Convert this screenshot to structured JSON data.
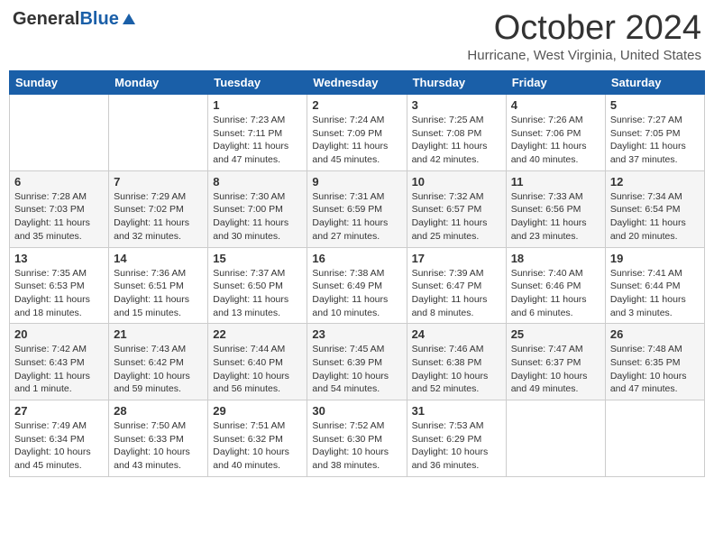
{
  "header": {
    "logo_general": "General",
    "logo_blue": "Blue",
    "month_title": "October 2024",
    "location": "Hurricane, West Virginia, United States"
  },
  "days_of_week": [
    "Sunday",
    "Monday",
    "Tuesday",
    "Wednesday",
    "Thursday",
    "Friday",
    "Saturday"
  ],
  "weeks": [
    [
      {
        "day": "",
        "info": ""
      },
      {
        "day": "",
        "info": ""
      },
      {
        "day": "1",
        "info": "Sunrise: 7:23 AM\nSunset: 7:11 PM\nDaylight: 11 hours and 47 minutes."
      },
      {
        "day": "2",
        "info": "Sunrise: 7:24 AM\nSunset: 7:09 PM\nDaylight: 11 hours and 45 minutes."
      },
      {
        "day": "3",
        "info": "Sunrise: 7:25 AM\nSunset: 7:08 PM\nDaylight: 11 hours and 42 minutes."
      },
      {
        "day": "4",
        "info": "Sunrise: 7:26 AM\nSunset: 7:06 PM\nDaylight: 11 hours and 40 minutes."
      },
      {
        "day": "5",
        "info": "Sunrise: 7:27 AM\nSunset: 7:05 PM\nDaylight: 11 hours and 37 minutes."
      }
    ],
    [
      {
        "day": "6",
        "info": "Sunrise: 7:28 AM\nSunset: 7:03 PM\nDaylight: 11 hours and 35 minutes."
      },
      {
        "day": "7",
        "info": "Sunrise: 7:29 AM\nSunset: 7:02 PM\nDaylight: 11 hours and 32 minutes."
      },
      {
        "day": "8",
        "info": "Sunrise: 7:30 AM\nSunset: 7:00 PM\nDaylight: 11 hours and 30 minutes."
      },
      {
        "day": "9",
        "info": "Sunrise: 7:31 AM\nSunset: 6:59 PM\nDaylight: 11 hours and 27 minutes."
      },
      {
        "day": "10",
        "info": "Sunrise: 7:32 AM\nSunset: 6:57 PM\nDaylight: 11 hours and 25 minutes."
      },
      {
        "day": "11",
        "info": "Sunrise: 7:33 AM\nSunset: 6:56 PM\nDaylight: 11 hours and 23 minutes."
      },
      {
        "day": "12",
        "info": "Sunrise: 7:34 AM\nSunset: 6:54 PM\nDaylight: 11 hours and 20 minutes."
      }
    ],
    [
      {
        "day": "13",
        "info": "Sunrise: 7:35 AM\nSunset: 6:53 PM\nDaylight: 11 hours and 18 minutes."
      },
      {
        "day": "14",
        "info": "Sunrise: 7:36 AM\nSunset: 6:51 PM\nDaylight: 11 hours and 15 minutes."
      },
      {
        "day": "15",
        "info": "Sunrise: 7:37 AM\nSunset: 6:50 PM\nDaylight: 11 hours and 13 minutes."
      },
      {
        "day": "16",
        "info": "Sunrise: 7:38 AM\nSunset: 6:49 PM\nDaylight: 11 hours and 10 minutes."
      },
      {
        "day": "17",
        "info": "Sunrise: 7:39 AM\nSunset: 6:47 PM\nDaylight: 11 hours and 8 minutes."
      },
      {
        "day": "18",
        "info": "Sunrise: 7:40 AM\nSunset: 6:46 PM\nDaylight: 11 hours and 6 minutes."
      },
      {
        "day": "19",
        "info": "Sunrise: 7:41 AM\nSunset: 6:44 PM\nDaylight: 11 hours and 3 minutes."
      }
    ],
    [
      {
        "day": "20",
        "info": "Sunrise: 7:42 AM\nSunset: 6:43 PM\nDaylight: 11 hours and 1 minute."
      },
      {
        "day": "21",
        "info": "Sunrise: 7:43 AM\nSunset: 6:42 PM\nDaylight: 10 hours and 59 minutes."
      },
      {
        "day": "22",
        "info": "Sunrise: 7:44 AM\nSunset: 6:40 PM\nDaylight: 10 hours and 56 minutes."
      },
      {
        "day": "23",
        "info": "Sunrise: 7:45 AM\nSunset: 6:39 PM\nDaylight: 10 hours and 54 minutes."
      },
      {
        "day": "24",
        "info": "Sunrise: 7:46 AM\nSunset: 6:38 PM\nDaylight: 10 hours and 52 minutes."
      },
      {
        "day": "25",
        "info": "Sunrise: 7:47 AM\nSunset: 6:37 PM\nDaylight: 10 hours and 49 minutes."
      },
      {
        "day": "26",
        "info": "Sunrise: 7:48 AM\nSunset: 6:35 PM\nDaylight: 10 hours and 47 minutes."
      }
    ],
    [
      {
        "day": "27",
        "info": "Sunrise: 7:49 AM\nSunset: 6:34 PM\nDaylight: 10 hours and 45 minutes."
      },
      {
        "day": "28",
        "info": "Sunrise: 7:50 AM\nSunset: 6:33 PM\nDaylight: 10 hours and 43 minutes."
      },
      {
        "day": "29",
        "info": "Sunrise: 7:51 AM\nSunset: 6:32 PM\nDaylight: 10 hours and 40 minutes."
      },
      {
        "day": "30",
        "info": "Sunrise: 7:52 AM\nSunset: 6:30 PM\nDaylight: 10 hours and 38 minutes."
      },
      {
        "day": "31",
        "info": "Sunrise: 7:53 AM\nSunset: 6:29 PM\nDaylight: 10 hours and 36 minutes."
      },
      {
        "day": "",
        "info": ""
      },
      {
        "day": "",
        "info": ""
      }
    ]
  ]
}
